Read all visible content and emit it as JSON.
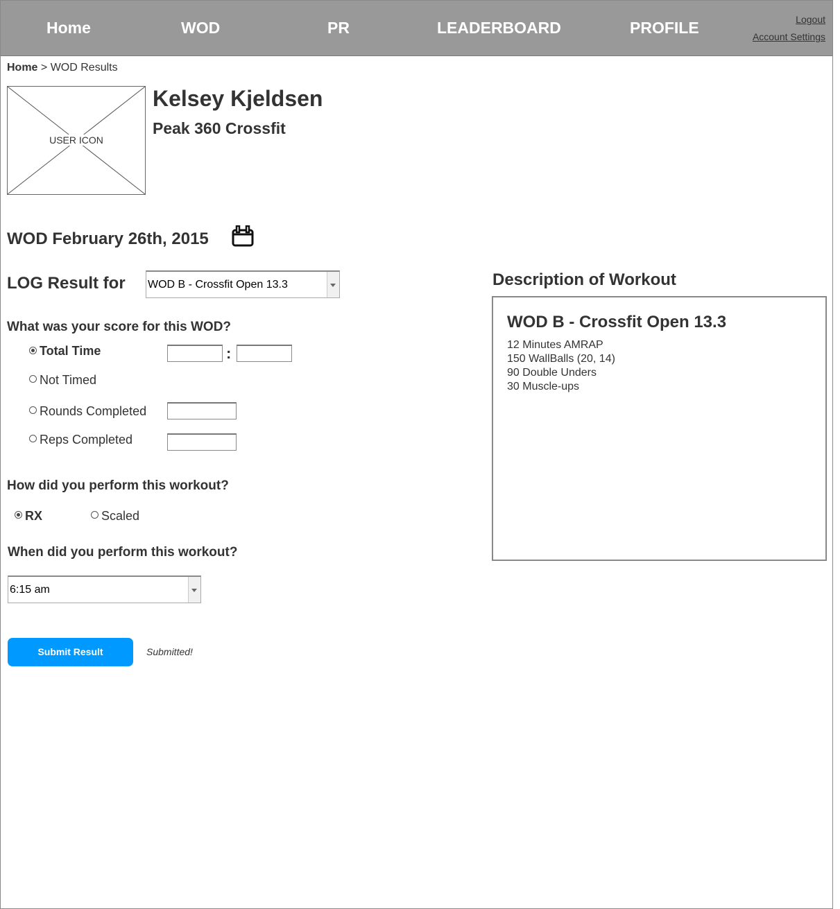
{
  "nav": {
    "items": [
      "Home",
      "WOD",
      "PR",
      "LEADERBOARD",
      "PROFILE"
    ],
    "logout": "Logout",
    "account_settings": "Account Settings"
  },
  "breadcrumb": {
    "home": "Home",
    "separator": " > ",
    "current": "WOD Results"
  },
  "user": {
    "icon_label": "USER ICON",
    "name": "Kelsey Kjeldsen",
    "gym": "Peak 360 Crossfit"
  },
  "wod_date": "WOD February 26th, 2015",
  "log": {
    "label": "LOG Result for",
    "selected_wod": "WOD B - Crossfit Open 13.3"
  },
  "score": {
    "question": "What was your score for this WOD?",
    "options": [
      "Total Time",
      "Not Timed",
      "Rounds Completed",
      "Reps Completed"
    ],
    "selected": "Total Time",
    "time_separator": ":",
    "time_minutes": "",
    "time_seconds": "",
    "rounds": "",
    "reps": ""
  },
  "performance": {
    "question": "How did you perform this workout?",
    "options": [
      "RX",
      "Scaled"
    ],
    "selected": "RX"
  },
  "when": {
    "question": "When did you perform this workout?",
    "selected_time": "6:15 am"
  },
  "submit": {
    "label": "Submit Result",
    "status": "Submitted!"
  },
  "description": {
    "title": "Description of Workout",
    "wod_name": "WOD B - Crossfit Open 13.3",
    "lines": [
      "12 Minutes AMRAP",
      "150 WallBalls (20, 14)",
      "90 Double Unders",
      "30 Muscle-ups"
    ]
  },
  "colors": {
    "nav_bg": "#999999",
    "nav_text": "#ffffff",
    "button": "#0099ff",
    "text": "#333333"
  }
}
